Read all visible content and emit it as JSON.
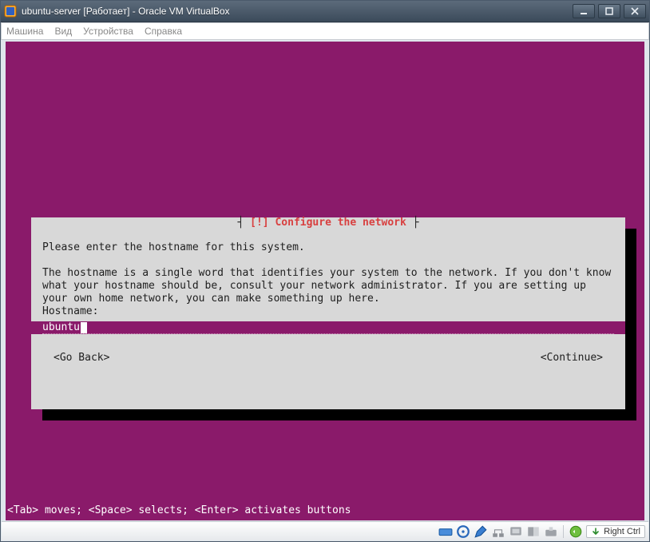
{
  "window": {
    "title": "ubuntu-server [Работает] - Oracle VM VirtualBox"
  },
  "menubar": {
    "items": [
      "Машина",
      "Вид",
      "Устройства",
      "Справка"
    ]
  },
  "installer": {
    "dialog_title": "[!] Configure the network",
    "intro": "Please enter the hostname for this system.",
    "description": "The hostname is a single word that identifies your system to the network. If you don't know what your hostname should be, consult your network administrator. If you are setting up your own home network, you can make something up here.",
    "field_label": "Hostname:",
    "hostname_value": "ubuntu",
    "go_back_label": "<Go Back>",
    "continue_label": "<Continue>",
    "hint": "<Tab> moves; <Space> selects; <Enter> activates buttons"
  },
  "statusbar": {
    "hostkey": "Right Ctrl",
    "icons": [
      "hdd-icon",
      "cd-icon",
      "pen-icon",
      "net-icon",
      "mouse-icon",
      "usb-icon",
      "share-icon",
      "sound-icon",
      "rec-icon"
    ]
  },
  "colors": {
    "installer_bg": "#8a1a6a",
    "dialog_bg": "#d8d8d8",
    "title_red": "#d84040"
  }
}
